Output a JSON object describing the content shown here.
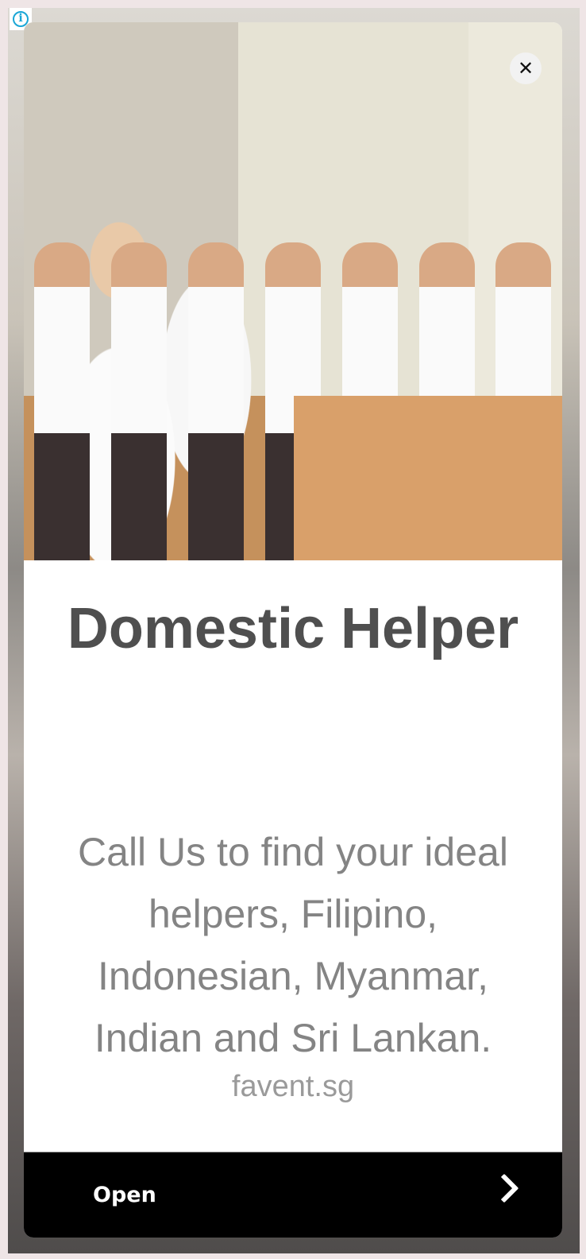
{
  "ad": {
    "title": "Domestic Helper",
    "description": "Call Us to find your ideal helpers, Filipino, Indonesian, Myanmar, Indian and Sri Lankan.",
    "domain": "favent.sg",
    "cta_label": "Open",
    "info_icon": "i",
    "close_icon": "✕"
  },
  "colors": {
    "accent_info": "#1aa6d6",
    "cta_background": "#000000"
  }
}
